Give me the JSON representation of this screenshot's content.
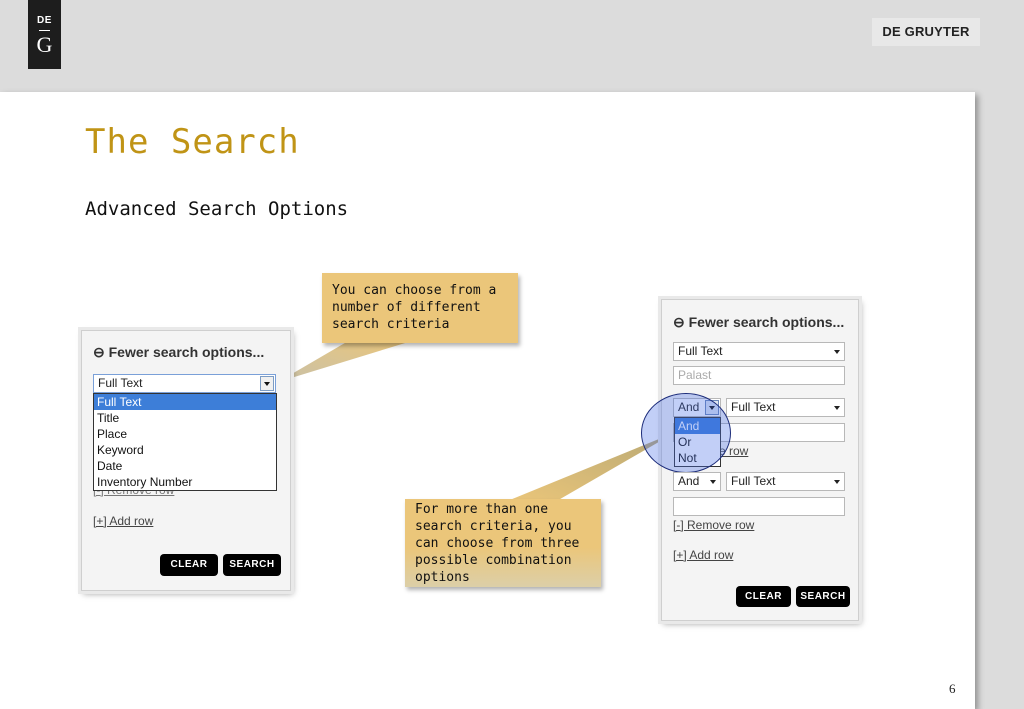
{
  "header": {
    "logo": {
      "top": "DE",
      "bottom": "G"
    },
    "brand": "DE GRUYTER"
  },
  "slide": {
    "title": "The Search",
    "subtitle": "Advanced Search Options",
    "page_number": "6"
  },
  "left_panel": {
    "heading": "⊖ Fewer search options...",
    "field_select": "Full Text",
    "dropdown_options": [
      "Full Text",
      "Title",
      "Place",
      "Keyword",
      "Date",
      "Inventory Number"
    ],
    "dropdown_selected": "Full Text",
    "remove_row": "[-] Remove row",
    "add_row": "[+] Add row",
    "clear_label": "CLEAR",
    "search_label": "SEARCH"
  },
  "right_panel": {
    "heading": "⊖ Fewer search options...",
    "row1_select": "Full Text",
    "row1_input": "Palast",
    "row2_op": "And",
    "row2_select": "Full Text",
    "op_options": [
      "And",
      "Or",
      "Not"
    ],
    "op_selected": "And",
    "remove_row_partial": "e row",
    "row3_op": "And",
    "row3_select": "Full Text",
    "remove_row": "[-] Remove row",
    "add_row": "[+] Add row",
    "clear_label": "CLEAR",
    "search_label": "SEARCH"
  },
  "callouts": {
    "top": [
      "You can choose from a",
      "number of different",
      "search criteria"
    ],
    "bottom": [
      "For more than one",
      "search criteria, you",
      "can choose from three",
      "possible combination",
      "options"
    ]
  },
  "colors": {
    "title": "#c09416",
    "callout": "#ebc67a",
    "highlight": "#3d7ed8",
    "button": "#000000"
  }
}
